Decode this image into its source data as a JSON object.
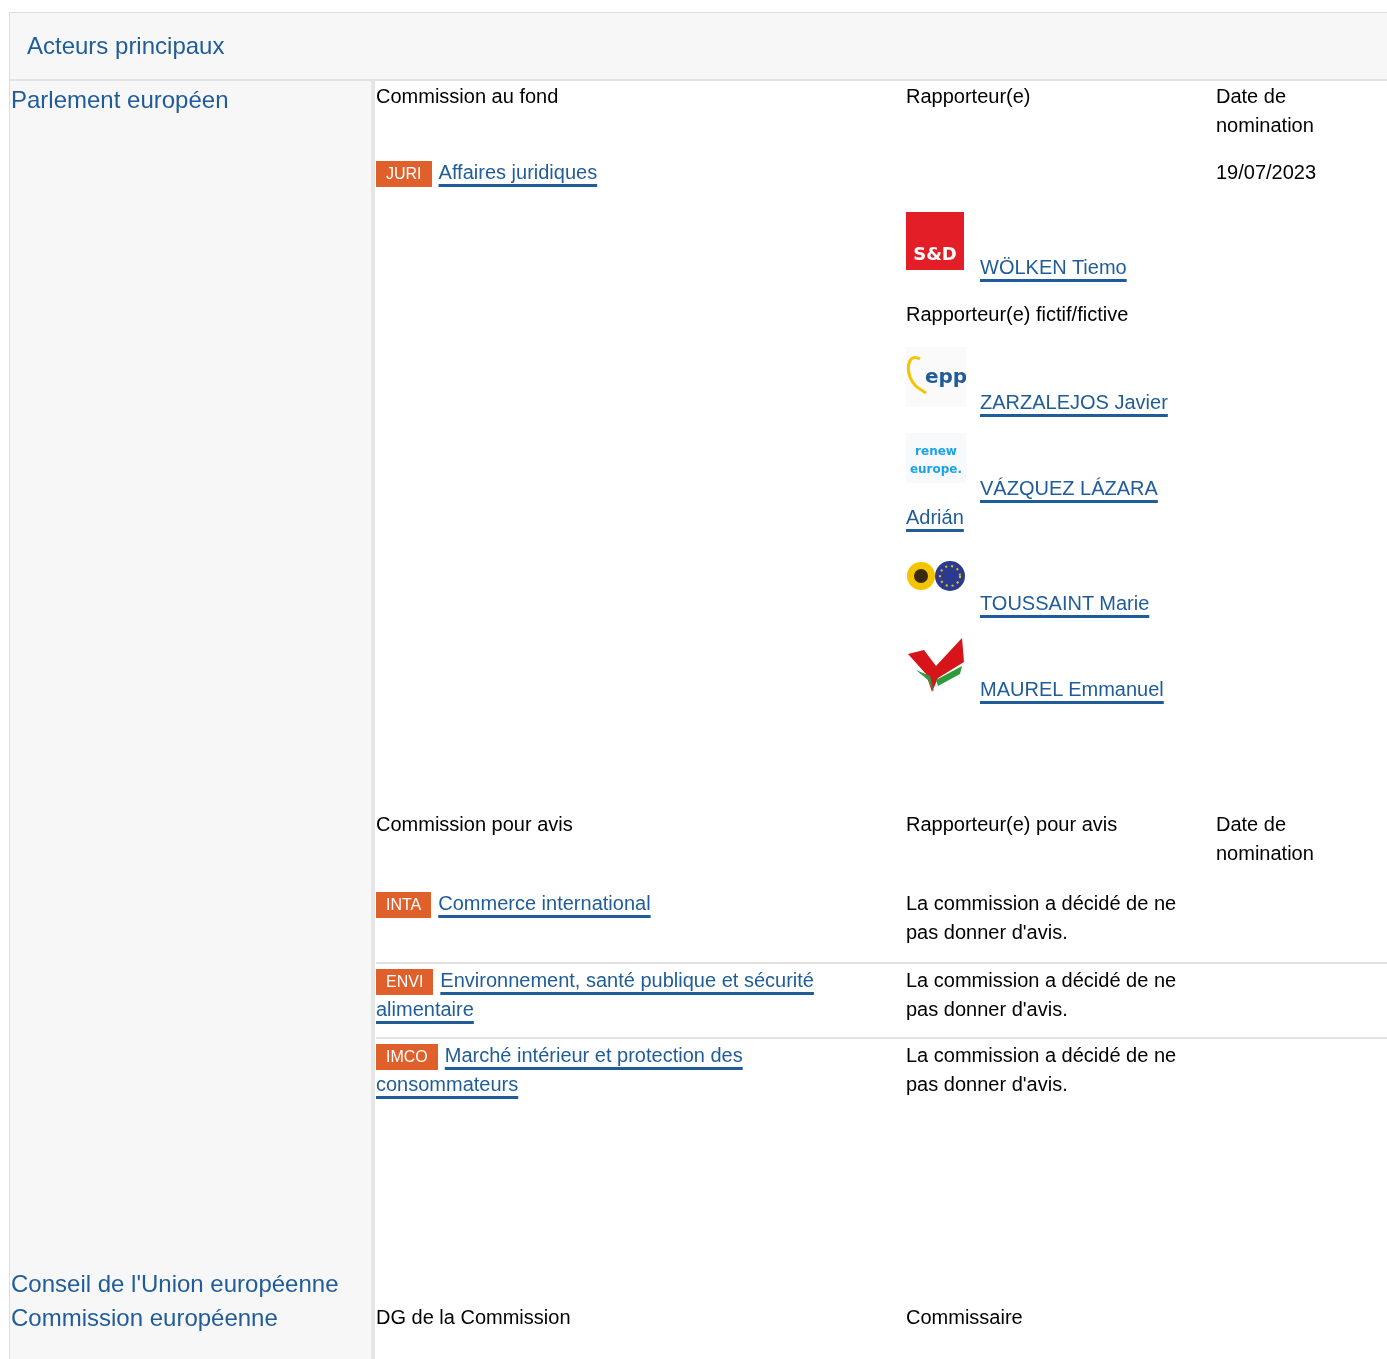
{
  "section_title": "Acteurs principaux",
  "parliament": {
    "name": "Parlement européen",
    "lead": {
      "headers": [
        "Commission au fond",
        "Rapporteur(e)",
        "Date de nomination"
      ],
      "committee": {
        "code": "JURI",
        "name": "Affaires juridiques"
      },
      "date": "19/07/2023",
      "rapporteurs": [
        {
          "name": "WÖLKEN Tiemo",
          "logo": {
            "kind": "sd",
            "text": [
              "S&D"
            ]
          }
        }
      ],
      "shadow_label": "Rapporteur(e) fictif/fictive",
      "shadow_rapporteurs": [
        {
          "name": "ZARZALEJOS Javier",
          "logo": {
            "kind": "epp",
            "text": [
              "epp"
            ]
          }
        },
        {
          "name": [
            "VÁZQUEZ LÁZARA",
            "Adrián"
          ],
          "logo": {
            "kind": "renew",
            "text": [
              "renew",
              "europe."
            ]
          }
        },
        {
          "name": "TOUSSAINT Marie",
          "logo": {
            "kind": "greens"
          }
        },
        {
          "name": "MAUREL Emmanuel",
          "logo": {
            "kind": "left"
          }
        }
      ]
    },
    "opinion": {
      "headers": [
        "Commission pour avis",
        "Rapporteur(e) pour avis",
        "Date de nomination"
      ],
      "committees": [
        {
          "code": "INTA",
          "name": "Commerce international",
          "rapporteur": "La commission a décidé de ne pas donner d'avis."
        },
        {
          "code": "ENVI",
          "name": [
            "Environnement, santé publique et sécurité",
            "alimentaire"
          ],
          "rapporteur": "La commission a décidé de ne pas donner d'avis."
        },
        {
          "code": "IMCO",
          "name": [
            "Marché intérieur et protection des",
            "consommateurs"
          ],
          "rapporteur": "La commission a décidé de ne pas donner d'avis."
        }
      ]
    }
  },
  "council": {
    "name": "Conseil de l'Union européenne"
  },
  "commission": {
    "name": "Commission européenne",
    "headers": [
      "DG de la Commission",
      "Commissaire"
    ]
  }
}
